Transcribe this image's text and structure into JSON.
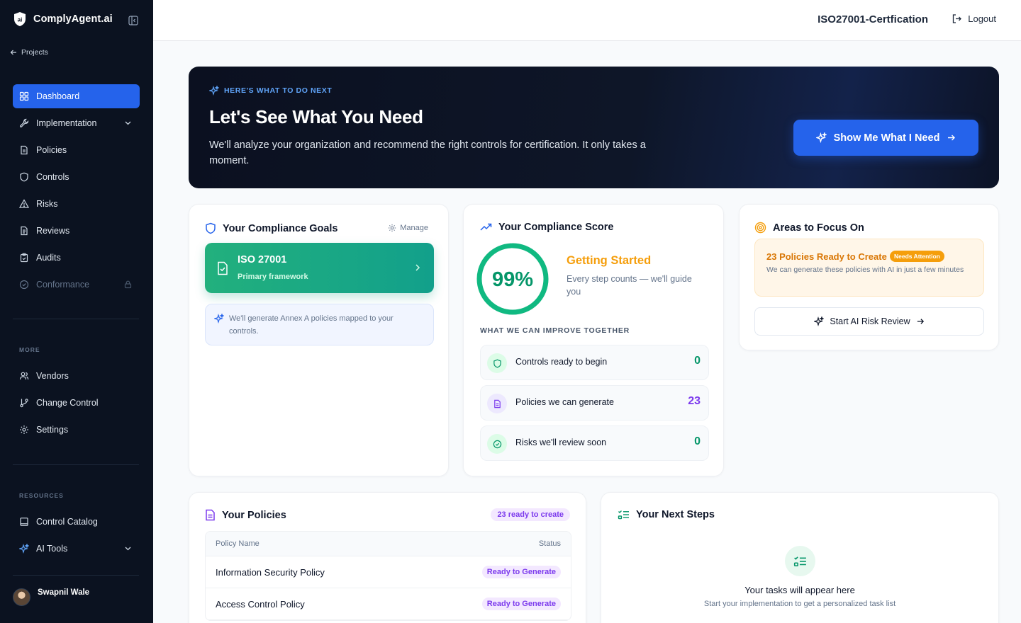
{
  "app": {
    "name": "ComplyAgent.ai",
    "logo_text": "ai"
  },
  "sidebar": {
    "back_label": "Projects",
    "main_items": [
      {
        "label": "Dashboard",
        "icon": "dashboard-icon",
        "active": true
      },
      {
        "label": "Implementation",
        "icon": "wrench-icon",
        "expandable": true
      },
      {
        "label": "Policies",
        "icon": "document-icon"
      },
      {
        "label": "Controls",
        "icon": "shield-icon"
      },
      {
        "label": "Risks",
        "icon": "warning-icon"
      },
      {
        "label": "Reviews",
        "icon": "file-text-icon"
      },
      {
        "label": "Audits",
        "icon": "clipboard-icon"
      },
      {
        "label": "Conformance",
        "icon": "check-circle-icon",
        "locked": true
      }
    ],
    "more_label": "MORE",
    "more_items": [
      {
        "label": "Vendors",
        "icon": "users-icon"
      },
      {
        "label": "Change Control",
        "icon": "git-branch-icon"
      },
      {
        "label": "Settings",
        "icon": "gear-icon"
      }
    ],
    "resources_label": "RESOURCES",
    "resource_items": [
      {
        "label": "Control Catalog",
        "icon": "book-icon"
      },
      {
        "label": "AI Tools",
        "icon": "sparkles-icon",
        "expandable": true
      }
    ],
    "user_name": "Swapnil Wale"
  },
  "topbar": {
    "project_title": "ISO27001-Certfication",
    "logout_label": "Logout"
  },
  "hero": {
    "kicker": "HERE'S WHAT TO DO NEXT",
    "title": "Let's See What You Need",
    "description": "We'll analyze your organization and recommend the right controls for certification. It only takes a moment.",
    "button_label": "Show Me What I Need"
  },
  "goals": {
    "title": "Your Compliance Goals",
    "manage_label": "Manage",
    "framework_name": "ISO 27001",
    "framework_sub": "Primary framework",
    "note": "We'll generate Annex A policies mapped to your controls."
  },
  "score": {
    "title": "Your Compliance Score",
    "value_text": "99%",
    "percent": 99,
    "status": "Getting Started",
    "description": "Every step counts — we'll guide you",
    "improve_label": "WHAT WE CAN IMPROVE TOGETHER",
    "metrics": [
      {
        "label": "Controls ready to begin",
        "value": "0",
        "color": "#059669",
        "icon": "shield-icon"
      },
      {
        "label": "Policies we can generate",
        "value": "23",
        "color": "#7c3aed",
        "icon": "document-icon"
      },
      {
        "label": "Risks we'll review soon",
        "value": "0",
        "color": "#059669",
        "icon": "check-circle-icon"
      }
    ]
  },
  "focus": {
    "title": "Areas to Focus On",
    "alert_title": "23 Policies Ready to Create",
    "badge": "Needs Attention",
    "alert_desc": "We can generate these policies with AI in just a few minutes",
    "button_label": "Start AI Risk Review"
  },
  "policies": {
    "title": "Your Policies",
    "ready_pill": "23 ready to create",
    "columns": [
      "Policy Name",
      "Status"
    ],
    "rows": [
      {
        "name": "Information Security Policy",
        "status": "Ready to Generate"
      },
      {
        "name": "Access Control Policy",
        "status": "Ready to Generate"
      }
    ]
  },
  "next_steps": {
    "title": "Your Next Steps",
    "empty_title": "Your tasks will appear here",
    "empty_sub": "Start your implementation to get a personalized task list"
  },
  "colors": {
    "primary": "#2563eb",
    "success": "#10b981",
    "warning": "#f59e0b",
    "purple": "#7c3aed",
    "sidebar_bg": "#0b1220"
  }
}
